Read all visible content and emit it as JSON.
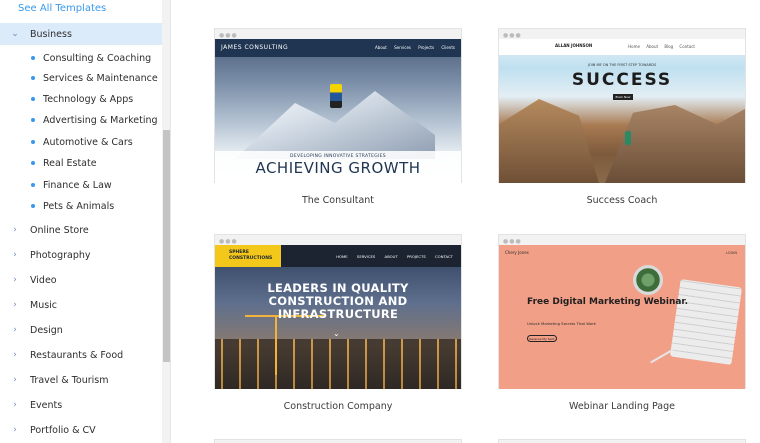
{
  "sidebar": {
    "see_all": "See All Templates",
    "active_category": "Business",
    "subcategories": [
      "Consulting & Coaching",
      "Services & Maintenance",
      "Technology & Apps",
      "Advertising & Marketing",
      "Automotive & Cars",
      "Real Estate",
      "Finance & Law",
      "Pets & Animals"
    ],
    "categories": [
      "Online Store",
      "Photography",
      "Video",
      "Music",
      "Design",
      "Restaurants & Food",
      "Travel & Tourism",
      "Events",
      "Portfolio & CV"
    ]
  },
  "templates": [
    {
      "label": "The Consultant",
      "preview": {
        "brand": "JAMES CONSULTING",
        "nav": "About Services Projects Clients",
        "subtitle": "DEVELOPING INNOVATIVE STRATEGIES",
        "title": "ACHIEVING GROWTH"
      }
    },
    {
      "label": "Success Coach",
      "preview": {
        "brand": "ALLAN JOHNSON",
        "nav": "Home About Blog Contact",
        "tagline": "JOIN ME ON THE FIRST STEP TOWARDS",
        "title": "SUCCESS",
        "button": "Book Now"
      }
    },
    {
      "label": "Construction Company",
      "preview": {
        "brand": "SPHERE CONSTRUCTIONS",
        "nav": "HOME SERVICES ABOUT PROJECTS CONTACT",
        "title": "LEADERS IN QUALITY CONSTRUCTION AND INFRASTRUCTURE"
      }
    },
    {
      "label": "Webinar Landing Page",
      "preview": {
        "brand": "Chery Jones",
        "nav": "LOGIN",
        "title": "Free Digital Marketing Webinar.",
        "description": "Unlock Marketing Secrets That Work",
        "button": "Reserve My Spot"
      }
    }
  ],
  "icons": {
    "chevron_down": "chevron-down-icon",
    "chevron_right": "chevron-right-icon"
  },
  "colors": {
    "accent": "#3899ec",
    "active_bg": "#dcebfa"
  }
}
